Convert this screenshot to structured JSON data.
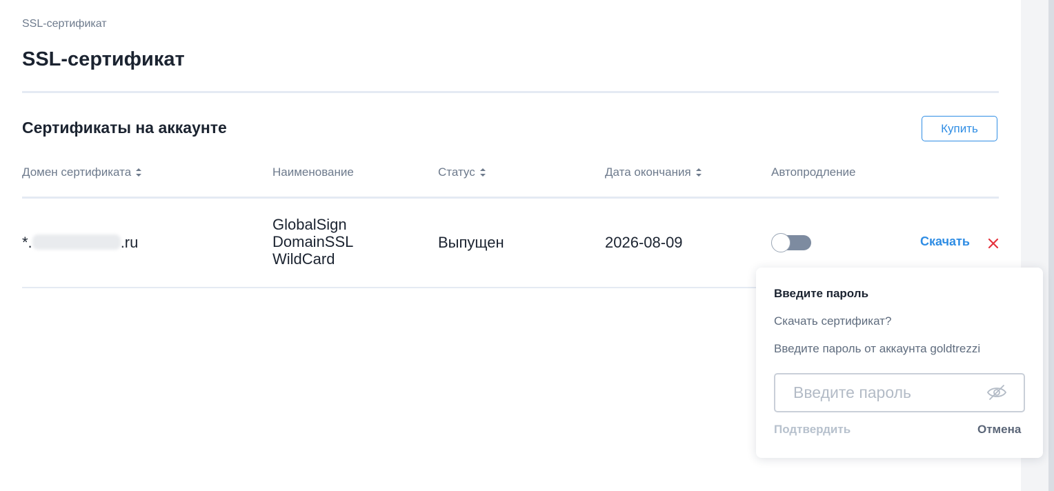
{
  "breadcrumb": "SSL-сертификат",
  "page_title": "SSL-сертификат",
  "section_title": "Сертификаты на аккаунте",
  "buy_button": "Купить",
  "table": {
    "headers": {
      "domain": "Домен сертификата",
      "name": "Наименование",
      "status": "Статус",
      "expiry": "Дата окончания",
      "autorenew": "Автопродление"
    },
    "rows": [
      {
        "domain_prefix": "*.",
        "domain_suffix": ".ru",
        "name_lines": [
          "GlobalSign",
          "DomainSSL",
          "WildCard"
        ],
        "status": "Выпущен",
        "expiry": "2026-08-09",
        "autorenew_on": false,
        "download_label": "Скачать"
      }
    ]
  },
  "popover": {
    "title": "Введите пароль",
    "question": "Скачать сертификат?",
    "hint": "Введите пароль от аккаунта goldtrezzi",
    "password_placeholder": "Введите пароль",
    "password_value": "",
    "confirm_label": "Подтвердить",
    "cancel_label": "Отмена"
  },
  "colors": {
    "accent": "#2f8de4",
    "danger": "#e5333d",
    "muted_text": "#6d7a8c",
    "toggle_off": "#7d8ba0"
  },
  "icons": {
    "sort": "sort-arrows-icon",
    "delete": "close-x-icon",
    "password_visibility": "eye-slash-icon"
  }
}
